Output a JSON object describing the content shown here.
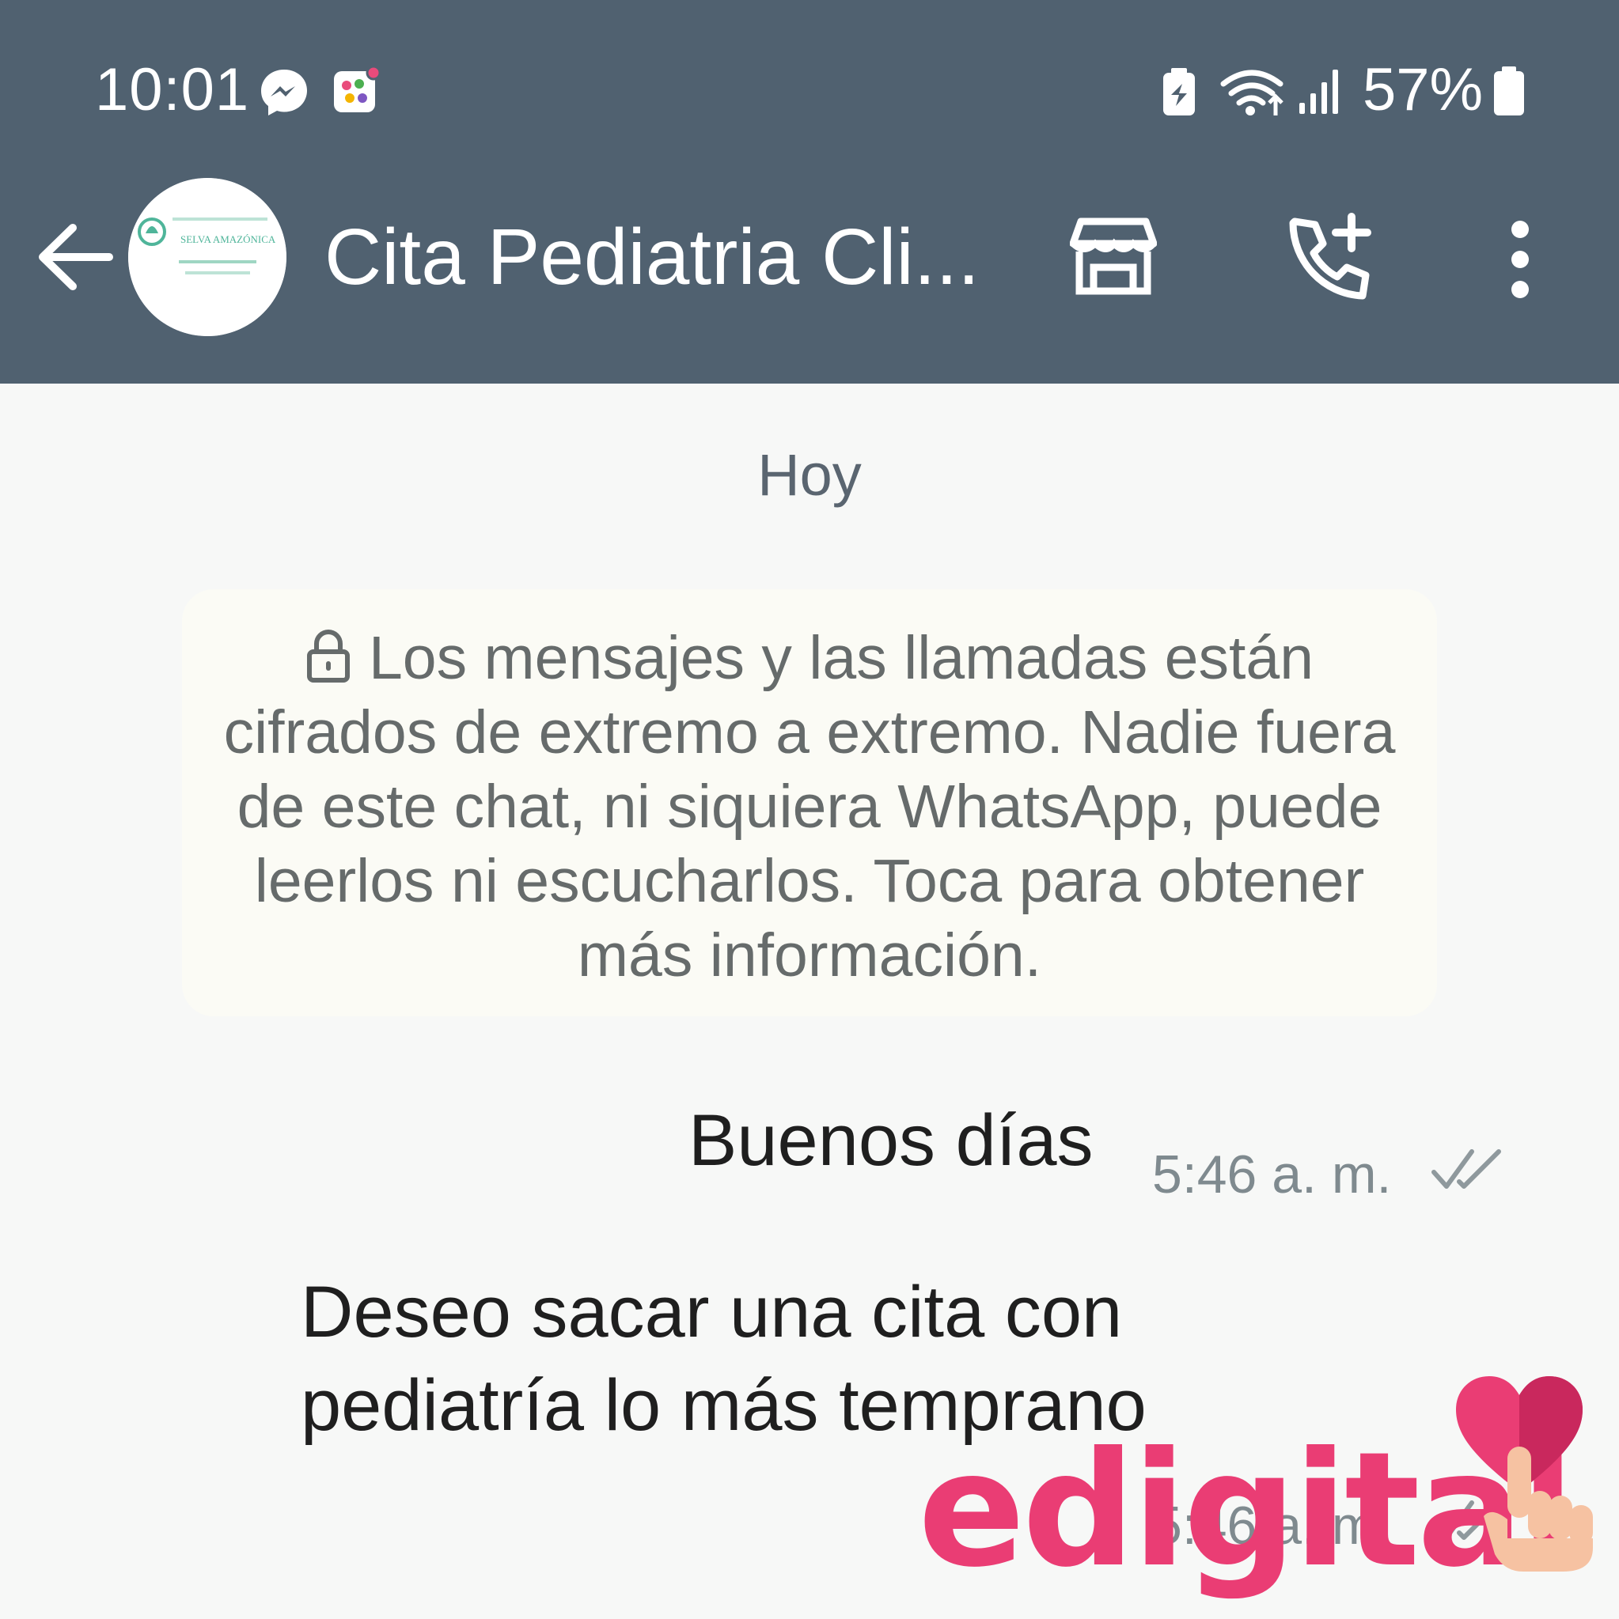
{
  "status_bar": {
    "time": "10:01",
    "battery_percent": "57%",
    "icons": [
      "messenger-icon",
      "app-notification-icon",
      "battery-saver-icon",
      "wifi-icon",
      "signal-icon",
      "battery-icon"
    ]
  },
  "header": {
    "title": "Cita Pediatria Cli...",
    "avatar_text": "SELVA AMAZÓNICA",
    "icons": [
      "back-arrow-icon",
      "store-icon",
      "add-call-icon",
      "more-vert-icon"
    ],
    "color": "#506170"
  },
  "chat": {
    "date_label": "Hoy",
    "encryption_notice": "Los mensajes y las llamadas están cifrados de extremo a extremo. Nadie fuera de este chat, ni siquiera WhatsApp, puede leerlos ni escucharlos. Toca para obtener más información.",
    "messages": [
      {
        "text": "Buenos días",
        "time": "5:46 a. m.",
        "status": "read"
      },
      {
        "text": "Deseo sacar una cita con pediatría lo más temprano",
        "time": "5:46 a. m.",
        "status": "read"
      }
    ]
  },
  "watermark": {
    "text": "edigital",
    "color": "#ea3d74"
  }
}
